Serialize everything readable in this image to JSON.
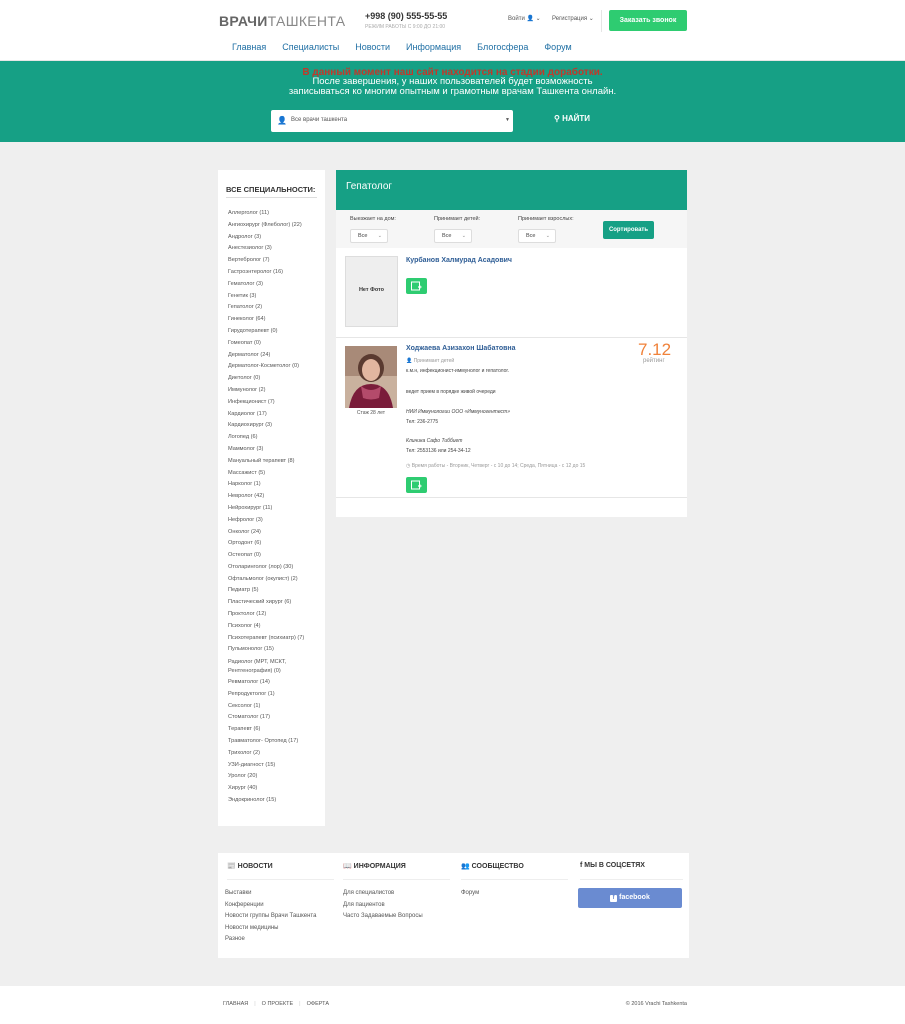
{
  "header": {
    "logo_bold": "ВРАЧИ",
    "logo_light": "ТАШКЕНТА",
    "phone": "+998 (90) 555-55-55",
    "hours": "РЕЖИМ РАБОТЫ С 9:00 ДО 21:00",
    "login": "Войти",
    "register": "Регистрация",
    "call_button": "Заказать звонок",
    "nav": [
      "Главная",
      "Специалисты",
      "Новости",
      "Информация",
      "Блогосфера",
      "Форум"
    ]
  },
  "banner": {
    "alert": "В данный момент наш сайт находится на стадии доработки.",
    "line1": "После завершения, у наших пользователей будет возможность",
    "line2": "записываться ко многим опытным и грамотным врачам Ташкента онлайн.",
    "search_value": "Все врачи ташкента",
    "find_button": "НАЙТИ"
  },
  "sidebar": {
    "title": "ВСЕ СПЕЦИАЛЬНОСТИ:",
    "items": [
      "Аллерголог (11)",
      "Ангиохирург (Флеболог) (22)",
      "Андролог (3)",
      "Анестезиолог (3)",
      "Вертебролог (7)",
      "Гастроэнтеролог (16)",
      "Гематолог (3)",
      "Генетик (3)",
      "Гепатолог (2)",
      "Гинеколог (64)",
      "Гирудотерапевт (0)",
      "Гомеопат (0)",
      "Дерматолог (24)",
      "Дерматолог-Косметолог (0)",
      "Диетолог (0)",
      "Иммунолог (2)",
      "Инфекционист (7)",
      "Кардиолог (17)",
      "Кардиохирург (3)",
      "Логопед (6)",
      "Маммолог (3)",
      "Мануальный терапевт (8)",
      "Массажист (5)",
      "Нарколог (1)",
      "Невролог (42)",
      "Нейрохирург (11)",
      "Нефролог (3)",
      "Онколог (24)",
      "Ортодонт (6)",
      "Остеопат (0)",
      "Отоларинголог (лор) (30)",
      "Офтальмолог (окулист) (2)",
      "Педиатр (5)",
      "Пластический хирург (6)",
      "Проктолог (12)",
      "Психолог (4)",
      "Психотерапевт (психиатр) (7)",
      "Пульмонолог (15)",
      "Радиолог (МРТ, МСКТ, Рентгенография) (0)",
      "Ревматолог (14)",
      "Репродуктолог (1)",
      "Сексолог (1)",
      "Стоматолог (17)",
      "Терапевт (6)",
      "Травматолог- Ортопед (17)",
      "Трихолог (2)",
      "УЗИ-диагност (15)",
      "Уролог (20)",
      "Хирург (40)",
      "Эндокринолог (15)"
    ]
  },
  "content": {
    "specialty": "Гепатолог",
    "filters": {
      "house_call_label": "Выезжает на дом:",
      "children_label": "Принимает детей:",
      "adults_label": "Принимает взрослых:",
      "house_call_value": "Все",
      "children_value": "Все",
      "adults_value": "Все",
      "sort_button": "Сортировать"
    },
    "doctors": [
      {
        "name": "Курбанов Халмурад Асадович",
        "no_photo": "Нет Фото"
      },
      {
        "name": "Ходжаева Азизахон Шабатовна",
        "experience": "Стаж 28 лет",
        "rating": "7.12",
        "rating_label": "рейтинг",
        "accepts_children": "Принимает детей",
        "desc1": "к.м.н, инфекционист-иммунолог и гепатолог.",
        "desc2": "ведет прием в порядке живой очереди",
        "org1": "НИИ Иммунологии ООО «Иммуногентест»",
        "tel1": "Тел: 236-2775",
        "org2": "Клиника Сафо Тиббиет",
        "tel2": "Тел: 2553136 или 254-34-12",
        "schedule": "Время работы - Вторник, Четверг - с 10 до 14; Среда, Пятница - с 12 до 15"
      }
    ]
  },
  "footer": {
    "news_title": "НОВОСТИ",
    "news_items": [
      "Выставки",
      "Конференции",
      "Новости группы Врачи Ташкента",
      "Новости медицины",
      "Разное"
    ],
    "info_title": "ИНФОРМАЦИЯ",
    "info_items": [
      "Для специалистов",
      "Для пациентов",
      "Часто Задаваемые Вопросы"
    ],
    "community_title": "СООБЩЕСТВО",
    "community_items": [
      "Форум"
    ],
    "social_title": "МЫ В СОЦСЕТЯХ",
    "facebook_button": "facebook",
    "bottom_links": [
      "ГЛАВНАЯ",
      "О ПРОЕКТЕ",
      "ОФЕРТА"
    ],
    "copyright": "© 2016 Vrachi Tashkenta"
  },
  "colors": {
    "primary": "#16a085",
    "green_button": "#2ecc71",
    "alert": "#c0392b",
    "link": "#2e5d95",
    "rating": "#f0823a",
    "facebook": "#6a8bd1"
  }
}
